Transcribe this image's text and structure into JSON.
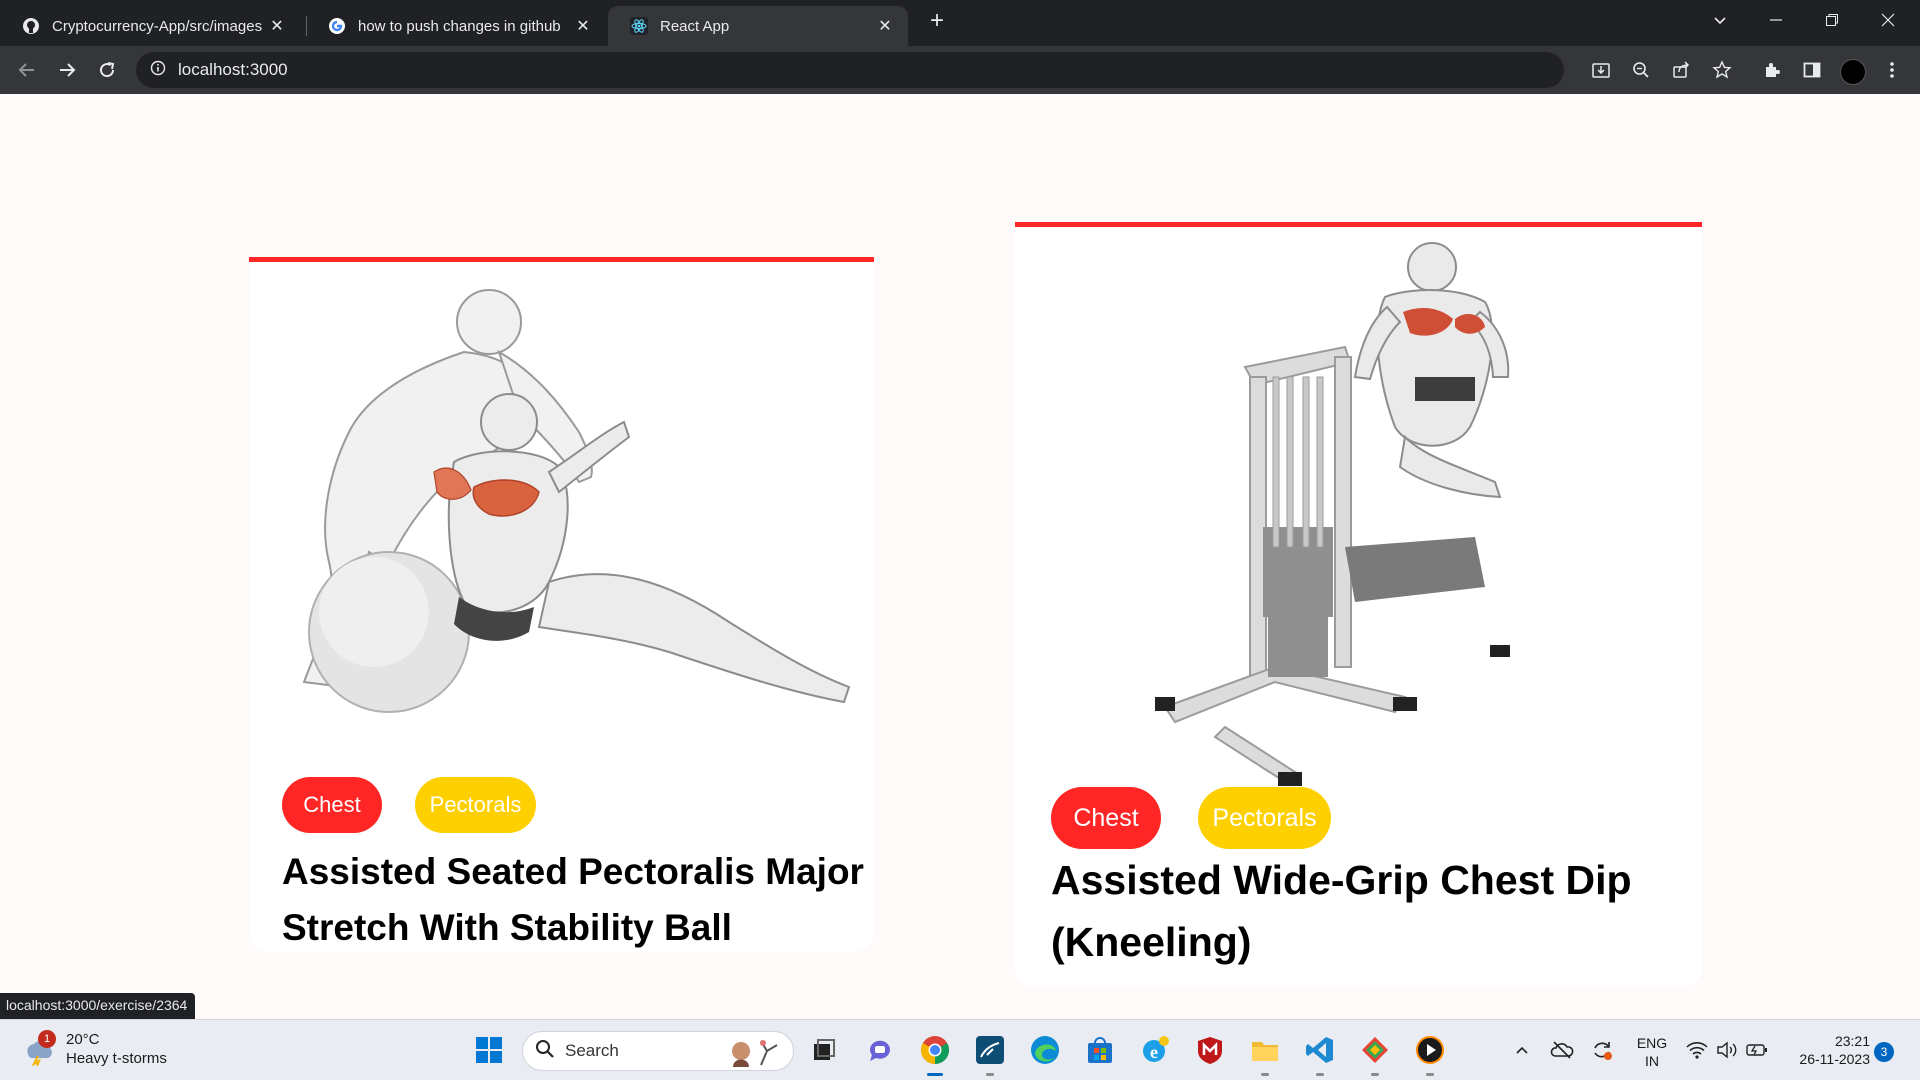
{
  "browser": {
    "tabs": [
      {
        "title": "Cryptocurrency-App/src/images",
        "icon": "github-icon"
      },
      {
        "title": "how to push changes in github",
        "icon": "google-icon"
      },
      {
        "title": "React App",
        "icon": "react-icon"
      }
    ],
    "url": "localhost:3000",
    "status_url": "localhost:3000/exercise/2364"
  },
  "exercises": [
    {
      "tags": [
        "Chest",
        "Pectorals"
      ],
      "name": "Assisted Seated Pectoralis Major Stretch With Stability Ball"
    },
    {
      "tags": [
        "Chest",
        "Pectorals"
      ],
      "name": "Assisted Wide-Grip Chest Dip (Kneeling)"
    }
  ],
  "colors": {
    "accent": "#ff2625",
    "tag_secondary": "#ffd000",
    "page_bg": "#fffafa"
  },
  "taskbar": {
    "weather": {
      "badge": "1",
      "temp": "20°C",
      "condition": "Heavy t-storms"
    },
    "search_label": "Search",
    "language": {
      "line1": "ENG",
      "line2": "IN"
    },
    "clock": {
      "time": "23:21",
      "date": "26-11-2023"
    },
    "notifications": "3"
  }
}
